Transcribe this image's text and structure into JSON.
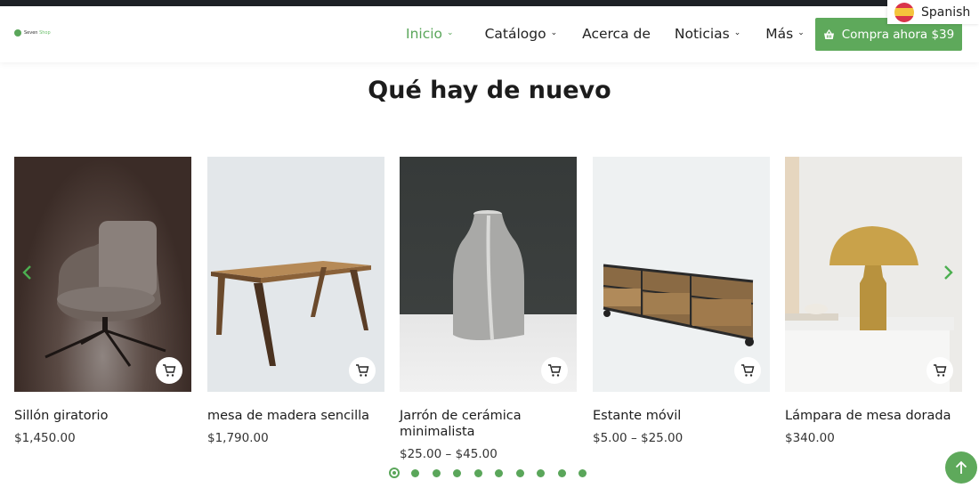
{
  "brand": {
    "name": "Seven",
    "accent": "Shop"
  },
  "nav": {
    "items": [
      {
        "label": "Inicio",
        "has_dropdown": true,
        "active": true
      },
      {
        "label": "Catálogo",
        "has_dropdown": true,
        "active": false
      },
      {
        "label": "Acerca de",
        "has_dropdown": false,
        "active": false
      },
      {
        "label": "Noticias",
        "has_dropdown": true,
        "active": false
      },
      {
        "label": "Más",
        "has_dropdown": true,
        "active": false
      }
    ],
    "chevron": "⌄"
  },
  "buy_button": {
    "label": "Compra ahora $39",
    "icon": "basket-icon"
  },
  "language": {
    "label": "Spanish",
    "icon": "spain-flag-icon"
  },
  "section": {
    "title": "Qué hay de nuevo"
  },
  "products": [
    {
      "name": "Sillón giratorio",
      "price": "$1,450.00"
    },
    {
      "name": "mesa de madera sencilla",
      "price": "$1,790.00"
    },
    {
      "name": "Jarrón de cerámica minimalista",
      "price": "$25.00 – $45.00"
    },
    {
      "name": "Estante móvil",
      "price": "$5.00 – $25.00"
    },
    {
      "name": "Lámpara de mesa dorada",
      "price": "$340.00"
    }
  ],
  "carousel": {
    "prev_icon": "‹",
    "next_icon": "›",
    "page_count": 10,
    "active_page": 1
  },
  "colors": {
    "accent": "#5ea95b",
    "dark_bar": "#1e2126"
  }
}
